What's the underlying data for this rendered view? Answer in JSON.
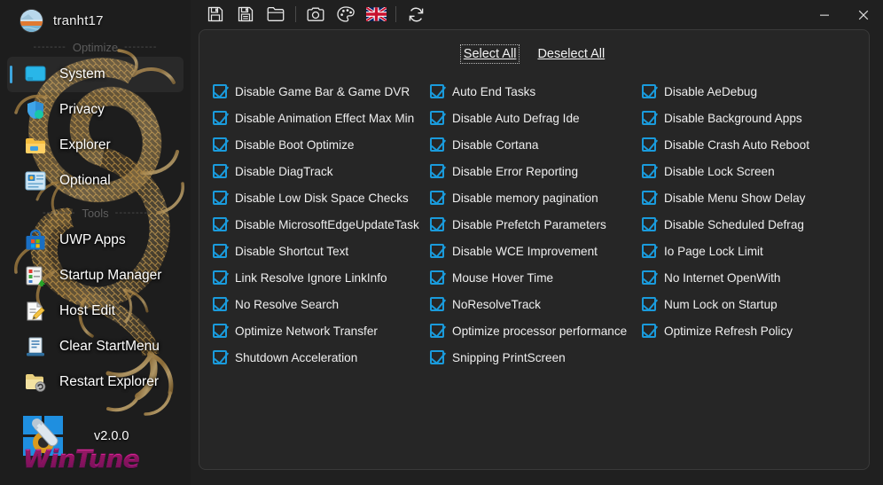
{
  "window": {
    "profile_name": "tranht17",
    "minimize_label": "–",
    "close_label": "✕"
  },
  "toolbar": {
    "items": [
      {
        "name": "save-icon",
        "tooltip": "Save"
      },
      {
        "name": "save-as-icon",
        "tooltip": "Save As"
      },
      {
        "name": "open-folder-icon",
        "tooltip": "Open"
      },
      {
        "name": "separator",
        "tooltip": ""
      },
      {
        "name": "camera-icon",
        "tooltip": "Screenshot"
      },
      {
        "name": "palette-icon",
        "tooltip": "Theme"
      },
      {
        "name": "flag-uk-icon",
        "tooltip": "Language"
      },
      {
        "name": "separator",
        "tooltip": ""
      },
      {
        "name": "refresh-icon",
        "tooltip": "Refresh"
      }
    ]
  },
  "sidebar": {
    "groups": [
      {
        "separator": "Optimize",
        "dashes": "--------",
        "items": [
          {
            "label": "System",
            "icon": "monitor-icon",
            "selected": true
          },
          {
            "label": "Privacy",
            "icon": "shield-icon",
            "selected": false
          },
          {
            "label": "Explorer",
            "icon": "folder-icon",
            "selected": false
          },
          {
            "label": "Optional",
            "icon": "optional-features-icon",
            "selected": false
          }
        ]
      },
      {
        "separator": "Tools",
        "dashes": "--------",
        "items": [
          {
            "label": "UWP Apps",
            "icon": "store-bag-icon",
            "selected": false
          },
          {
            "label": "Startup Manager",
            "icon": "startup-list-icon",
            "selected": false
          },
          {
            "label": "Host Edit",
            "icon": "file-pencil-icon",
            "selected": false
          },
          {
            "label": "Clear StartMenu",
            "icon": "start-menu-icon",
            "selected": false
          },
          {
            "label": "Restart Explorer",
            "icon": "folder-refresh-icon",
            "selected": false
          }
        ]
      }
    ],
    "brand": {
      "version": "v2.0.0",
      "name": "WinTune",
      "logo_icon": "wintune-logo-icon"
    }
  },
  "main": {
    "select_all_label": "Select All",
    "deselect_all_label": "Deselect All",
    "columns": [
      {
        "items": [
          {
            "label": "Disable Game Bar & Game DVR",
            "checked": true
          },
          {
            "label": "Disable Animation Effect Max Min",
            "checked": true
          },
          {
            "label": "Disable Boot Optimize",
            "checked": true
          },
          {
            "label": "Disable DiagTrack",
            "checked": true
          },
          {
            "label": "Disable Low Disk Space Checks",
            "checked": true
          },
          {
            "label": "Disable MicrosoftEdgeUpdateTask",
            "checked": true
          },
          {
            "label": "Disable Shortcut Text",
            "checked": true
          },
          {
            "label": "Link Resolve Ignore LinkInfo",
            "checked": true
          },
          {
            "label": "No Resolve Search",
            "checked": true
          },
          {
            "label": "Optimize Network Transfer",
            "checked": true
          },
          {
            "label": "Shutdown Acceleration",
            "checked": true
          }
        ]
      },
      {
        "items": [
          {
            "label": "Auto End Tasks",
            "checked": true
          },
          {
            "label": "Disable Auto Defrag Ide",
            "checked": true
          },
          {
            "label": "Disable Cortana",
            "checked": true
          },
          {
            "label": "Disable Error Reporting",
            "checked": true
          },
          {
            "label": "Disable memory pagination",
            "checked": true
          },
          {
            "label": "Disable Prefetch Parameters",
            "checked": true
          },
          {
            "label": "Disable WCE Improvement",
            "checked": true
          },
          {
            "label": "Mouse Hover Time",
            "checked": true
          },
          {
            "label": "NoResolveTrack",
            "checked": true
          },
          {
            "label": "Optimize processor performance",
            "checked": true
          },
          {
            "label": "Snipping PrintScreen",
            "checked": true
          }
        ]
      },
      {
        "items": [
          {
            "label": "Disable AeDebug",
            "checked": true
          },
          {
            "label": "Disable Background Apps",
            "checked": true
          },
          {
            "label": "Disable Crash Auto Reboot",
            "checked": true
          },
          {
            "label": "Disable Lock Screen",
            "checked": true
          },
          {
            "label": "Disable Menu Show Delay",
            "checked": true
          },
          {
            "label": "Disable Scheduled Defrag",
            "checked": true
          },
          {
            "label": "Io Page Lock Limit",
            "checked": true
          },
          {
            "label": "No Internet OpenWith",
            "checked": true
          },
          {
            "label": "Num Lock on Startup",
            "checked": true
          },
          {
            "label": "Optimize Refresh Policy",
            "checked": true
          }
        ]
      }
    ]
  },
  "colors": {
    "accent": "#1a9bdc",
    "selection_bar": "#3ea5dd",
    "background": "#202020",
    "panel": "#262626",
    "brand_pink": "#f0209f"
  }
}
